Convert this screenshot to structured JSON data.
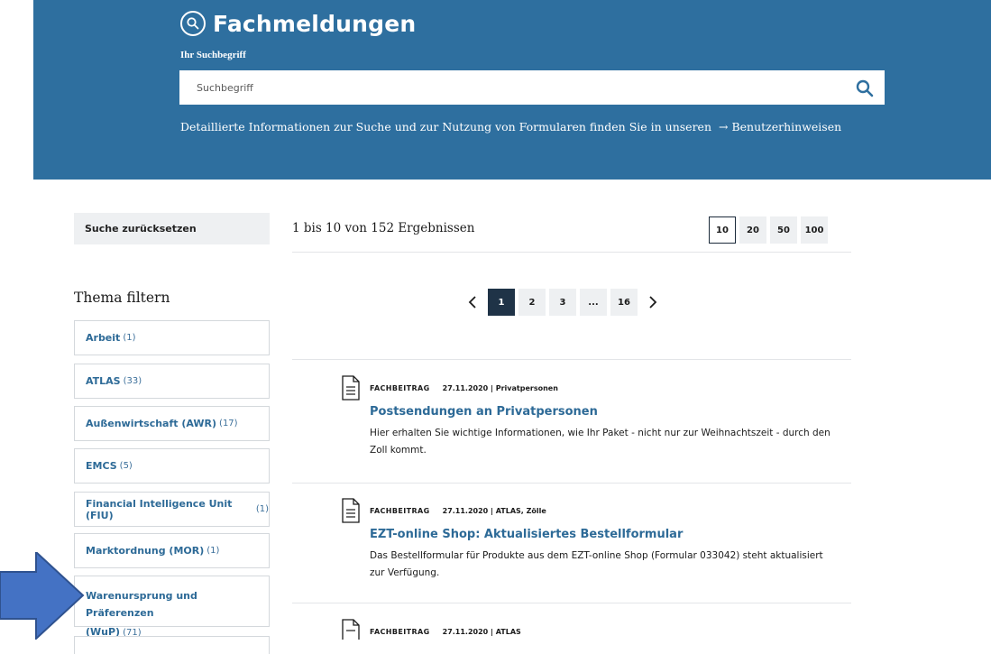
{
  "header": {
    "title": "Fachmeldungen",
    "search_label": "Ihr Suchbegriff",
    "search_placeholder": "Suchbegriff",
    "search_value": "",
    "info_text": "Detaillierte Informationen zur Suche und zur Nutzung von Formularen finden Sie in unseren",
    "info_link": "Benutzerhinweisen",
    "bg_color": "#2e6f9f"
  },
  "toolbar": {
    "reset_label": "Suche zurücksetzen",
    "result_count": "1 bis 10 von 152 Ergebnissen",
    "per_page": [
      "10",
      "20",
      "50",
      "100"
    ],
    "per_page_active": "10"
  },
  "filters": {
    "title": "Thema filtern",
    "items": [
      {
        "label": "Arbeit",
        "count": "(1)"
      },
      {
        "label": "ATLAS",
        "count": "(33)"
      },
      {
        "label": "Außenwirtschaft (AWR)",
        "count": "(17)"
      },
      {
        "label": "EMCS",
        "count": "(5)"
      },
      {
        "label": "Financial Intelligence Unit (FIU)",
        "count": "(1)"
      },
      {
        "label": "Marktordnung (MOR)",
        "count": "(1)"
      },
      {
        "label_line1": "Warenursprung und Präferenzen",
        "label_line2": "(WuP)",
        "count": "(71)"
      }
    ]
  },
  "pagination": {
    "pages": [
      "1",
      "2",
      "3",
      "...",
      "16"
    ],
    "active": "1"
  },
  "results": [
    {
      "type": "FACHBEITRAG",
      "meta": "27.11.2020 | Privatpersonen",
      "title": "Postsendungen an Privatpersonen",
      "desc": "Hier erhalten Sie wichtige Informationen, wie Ihr Paket - nicht nur zur Weihnachtszeit - durch den Zoll kommt."
    },
    {
      "type": "FACHBEITRAG",
      "meta": "27.11.2020 | ATLAS, Zölle",
      "title": "EZT-online Shop: Aktualisiertes Bestellformular",
      "desc": "Das Bestellformular für Produkte aus dem EZT-online Shop (Formular 033042) steht aktualisiert zur Verfügung."
    },
    {
      "type": "FACHBEITRAG",
      "meta": "27.11.2020 | ATLAS",
      "title": "",
      "desc": ""
    }
  ],
  "colors": {
    "accent": "#2d6a97",
    "annotation_arrow": "#4472c4"
  }
}
